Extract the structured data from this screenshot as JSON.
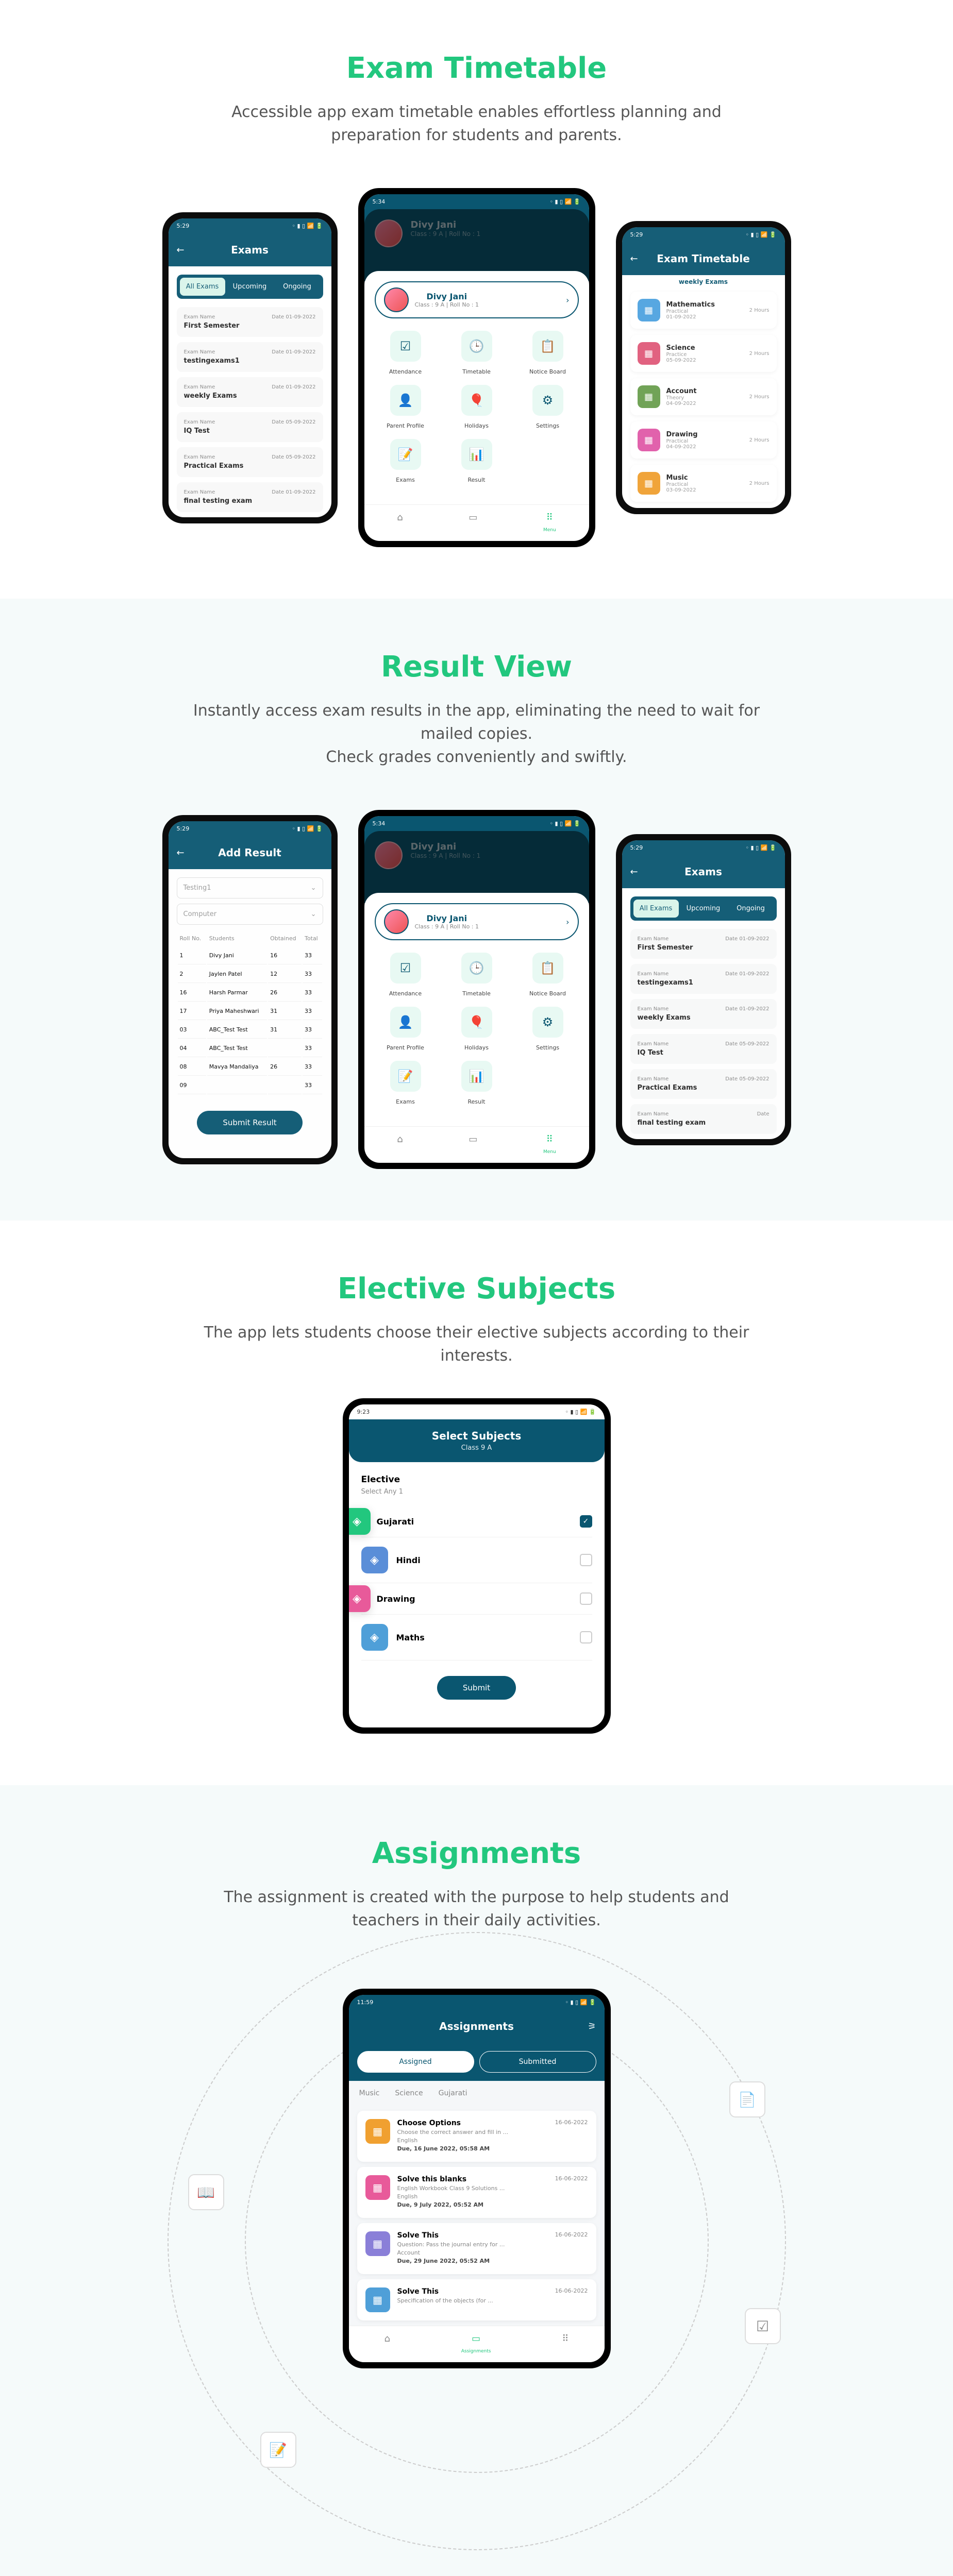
{
  "s1": {
    "title": "Exam Timetable",
    "description": "Accessible app exam timetable enables effortless planning and preparation for students and parents.",
    "left": {
      "time": "5:29",
      "header": "Exams",
      "tabs": [
        "All Exams",
        "Upcoming",
        "Ongoing"
      ],
      "activeTab": 0,
      "exams": [
        {
          "label": "Exam Name",
          "name": "First Semester",
          "dlabel": "Date",
          "date": "01-09-2022"
        },
        {
          "label": "Exam Name",
          "name": "testingexams1",
          "dlabel": "Date",
          "date": "01-09-2022"
        },
        {
          "label": "Exam Name",
          "name": "weekly Exams",
          "dlabel": "Date",
          "date": "01-09-2022"
        },
        {
          "label": "Exam Name",
          "name": "IQ Test",
          "dlabel": "Date",
          "date": "05-09-2022"
        },
        {
          "label": "Exam Name",
          "name": "Practical Exams",
          "dlabel": "Date",
          "date": "05-09-2022"
        },
        {
          "label": "Exam Name",
          "name": "final testing exam",
          "dlabel": "Date",
          "date": "01-09-2022"
        }
      ]
    },
    "center": {
      "time": "5:34",
      "dimName": "Divy Jani",
      "dimClass": "Class : 9 A  |  Roll No : 1",
      "profile": {
        "name": "Divy Jani",
        "class": "Class : 9 A  |  Roll No : 1"
      },
      "menu": [
        "Attendance",
        "Timetable",
        "Notice Board",
        "Parent Profile",
        "Holidays",
        "Settings",
        "Exams",
        "Result"
      ],
      "navMenu": "Menu"
    },
    "right": {
      "time": "5:29",
      "header": "Exam Timetable",
      "sectionLabel": "weekly Exams",
      "items": [
        {
          "color": "#4fa3e0",
          "subject": "Mathematics",
          "detail": "Practical",
          "date": "01-09-2022",
          "time": "2 Hours"
        },
        {
          "color": "#e05a7a",
          "subject": "Science",
          "detail": "Practice",
          "date": "05-09-2022",
          "time": "2 Hours"
        },
        {
          "color": "#6a9f4f",
          "subject": "Account",
          "detail": "Theory",
          "date": "04-09-2022",
          "time": "2 Hours"
        },
        {
          "color": "#e05aa8",
          "subject": "Drawing",
          "detail": "Practical",
          "date": "04-09-2022",
          "time": "2 Hours"
        },
        {
          "color": "#f0a030",
          "subject": "Music",
          "detail": "Practical",
          "date": "03-09-2022",
          "time": "2 Hours"
        }
      ]
    }
  },
  "s2": {
    "title": "Result View",
    "description": "Instantly access exam results in the app, eliminating the need to wait for mailed copies.\nCheck grades conveniently and swiftly.",
    "left": {
      "time": "5:29",
      "header": "Add Result",
      "select1": "Testing1",
      "select2": "Computer",
      "cols": [
        "Roll No.",
        "Students",
        "Obtained",
        "Total"
      ],
      "rows": [
        [
          "1",
          "Divy Jani",
          "16",
          "33"
        ],
        [
          "2",
          "Jaylen Patel",
          "12",
          "33"
        ],
        [
          "16",
          "Harsh Parmar",
          "26",
          "33"
        ],
        [
          "17",
          "Priya Maheshwari",
          "31",
          "33"
        ],
        [
          "03",
          "ABC_Test Test",
          "31",
          "33"
        ],
        [
          "04",
          "ABC_Test Test",
          "",
          "33"
        ],
        [
          "08",
          "Mavya Mandaliya",
          "26",
          "33"
        ],
        [
          "09",
          "",
          "",
          "33"
        ]
      ],
      "submit": "Submit Result"
    },
    "center": {
      "time": "5:34",
      "profile": {
        "name": "Divy Jani",
        "class": "Class : 9 A  |  Roll No : 1"
      },
      "menu": [
        "Attendance",
        "Timetable",
        "Notice Board",
        "Parent Profile",
        "Holidays",
        "Settings",
        "Exams",
        "Result"
      ],
      "navMenu": "Menu"
    },
    "right": {
      "time": "5:29",
      "header": "Exams",
      "tabs": [
        "All Exams",
        "Upcoming",
        "Ongoing"
      ],
      "exams": [
        {
          "label": "Exam Name",
          "name": "First Semester",
          "dlabel": "Date",
          "date": "01-09-2022"
        },
        {
          "label": "Exam Name",
          "name": "testingexams1",
          "dlabel": "Date",
          "date": "01-09-2022"
        },
        {
          "label": "Exam Name",
          "name": "weekly Exams",
          "dlabel": "Date",
          "date": "01-09-2022"
        },
        {
          "label": "Exam Name",
          "name": "IQ Test",
          "dlabel": "Date",
          "date": "05-09-2022"
        },
        {
          "label": "Exam Name",
          "name": "Practical Exams",
          "dlabel": "Date",
          "date": "05-09-2022"
        },
        {
          "label": "Exam Name",
          "name": "final testing exam",
          "dlabel": "Date",
          "date": ""
        }
      ]
    }
  },
  "s3": {
    "title": "Elective Subjects",
    "description": "The app lets students choose their elective subjects according to their interests.",
    "time": "9:23",
    "header": "Select Subjects",
    "classLabel": "Class 9 A",
    "electiveLabel": "Elective",
    "selectAny": "Select Any 1",
    "subjects": [
      {
        "color": "#22c77e",
        "name": "Gujarati",
        "checked": true,
        "float": true
      },
      {
        "color": "#5a8ed8",
        "name": "Hindi",
        "checked": false,
        "float": false
      },
      {
        "color": "#e85a9a",
        "name": "Drawing",
        "checked": false,
        "float": true
      },
      {
        "color": "#4f9fd8",
        "name": "Maths",
        "checked": false,
        "float": false
      }
    ],
    "submit": "Submit"
  },
  "s4": {
    "title": "Assignments",
    "description": "The assignment is created with the purpose to help students and teachers in their daily activities.",
    "time": "11:59",
    "header": "Assignments",
    "mainTabs": [
      "Assigned",
      "Submitted"
    ],
    "subjTabs": [
      "Music",
      "Science",
      "Gujarati"
    ],
    "items": [
      {
        "color": "#f0a030",
        "title": "Choose Options",
        "date": "16-06-2022",
        "desc": "Choose the correct answer and fill in ...",
        "subj": "English",
        "due": "Due, 16 June 2022, 05:58 AM"
      },
      {
        "color": "#e85a9a",
        "title": "Solve this blanks",
        "date": "16-06-2022",
        "desc": "English Workbook Class 9 Solutions ...",
        "subj": "English",
        "due": "Due, 9 July 2022, 05:52 AM"
      },
      {
        "color": "#8a7fd8",
        "title": "Solve This",
        "date": "16-06-2022",
        "desc": "Question: Pass the journal entry for ...",
        "subj": "Account",
        "due": "Due, 29 June 2022, 05:52 AM"
      },
      {
        "color": "#4f9fd8",
        "title": "Solve This",
        "date": "16-06-2022",
        "desc": "Specification of the objects (for ...",
        "subj": "",
        "due": ""
      }
    ],
    "navLabel": "Assignments"
  }
}
